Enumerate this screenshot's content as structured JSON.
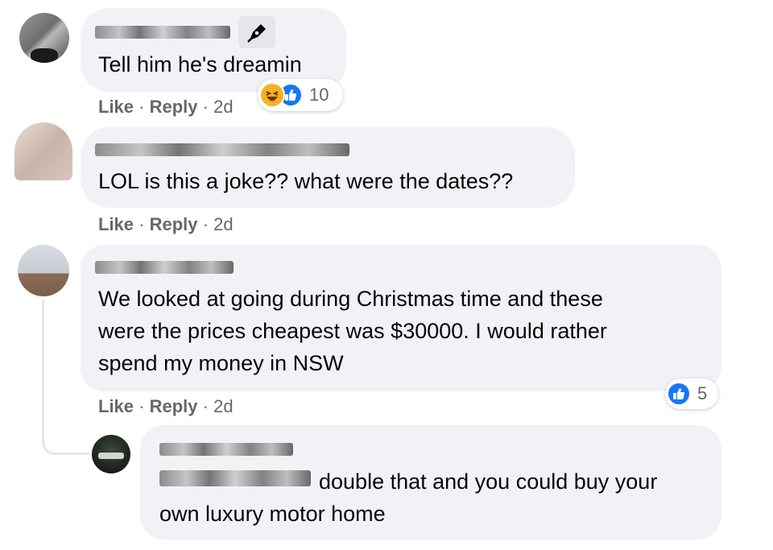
{
  "comments": [
    {
      "text": "Tell him he's dreamin",
      "meta": {
        "like": "Like",
        "sep1": " · ",
        "reply": "Reply",
        "sep2": " · ",
        "time": "2d"
      },
      "reactions": {
        "icons": [
          "haha-icon",
          "like-icon"
        ],
        "count": "10"
      },
      "badge_icon": "pen-icon"
    },
    {
      "text": "LOL is this a joke?? what were the dates??",
      "meta": {
        "like": "Like",
        "sep1": " · ",
        "reply": "Reply",
        "sep2": " · ",
        "time": "2d"
      }
    },
    {
      "lines": [
        "We looked at going during Christmas time and these",
        "were the prices cheapest was $30000. I would rather",
        "spend my money in NSW"
      ],
      "meta": {
        "like": "Like",
        "sep1": " · ",
        "reply": "Reply",
        "sep2": " · ",
        "time": "2d"
      },
      "reactions": {
        "icons": [
          "like-icon"
        ],
        "count": "5"
      }
    }
  ],
  "reply": {
    "line1": "double that and you could buy your",
    "line2": "own luxury motor home"
  },
  "colors": {
    "bubble": "#f0f2f5",
    "meta": "#65676b",
    "like_blue": "#1877f2",
    "haha_yellow": "#f7b125"
  }
}
